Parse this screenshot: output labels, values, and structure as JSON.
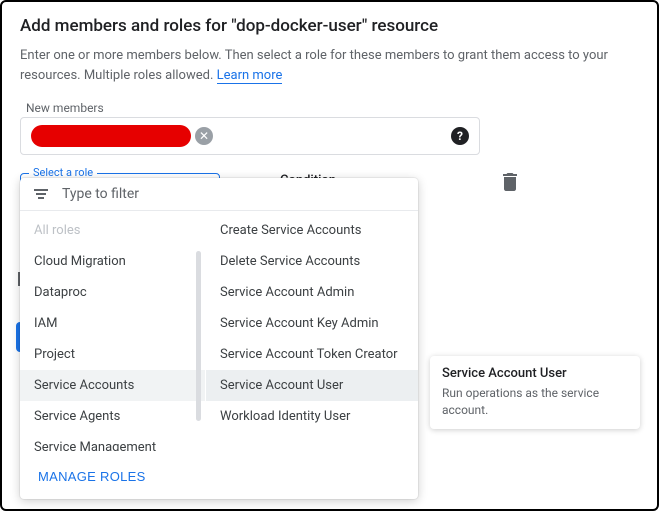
{
  "header": {
    "title": "Add members and roles for \"dop-docker-user\" resource",
    "subtitle_a": "Enter one or more members below. Then select a role for these members to grant them access to your resources. Multiple roles allowed. ",
    "learn_more": "Learn more"
  },
  "members": {
    "label": "New members",
    "help": "?"
  },
  "role_select": {
    "label": "Select a role",
    "condition_label": "Condition"
  },
  "dropdown": {
    "filter_placeholder": "Type to filter",
    "categories": [
      {
        "label": "All roles",
        "faded": true
      },
      {
        "label": "Cloud Migration"
      },
      {
        "label": "Dataproc"
      },
      {
        "label": "IAM"
      },
      {
        "label": "Project"
      },
      {
        "label": "Service Accounts",
        "selected": true
      },
      {
        "label": "Service Agents"
      },
      {
        "label": "Service Management"
      }
    ],
    "roles": [
      {
        "label": "Create Service Accounts"
      },
      {
        "label": "Delete Service Accounts"
      },
      {
        "label": "Service Account Admin"
      },
      {
        "label": "Service Account Key Admin"
      },
      {
        "label": "Service Account Token Creator"
      },
      {
        "label": "Service Account User",
        "selected": true
      },
      {
        "label": "Workload Identity User"
      }
    ],
    "manage_roles": "MANAGE ROLES"
  },
  "tooltip": {
    "title": "Service Account User",
    "body": "Run operations as the service account."
  }
}
